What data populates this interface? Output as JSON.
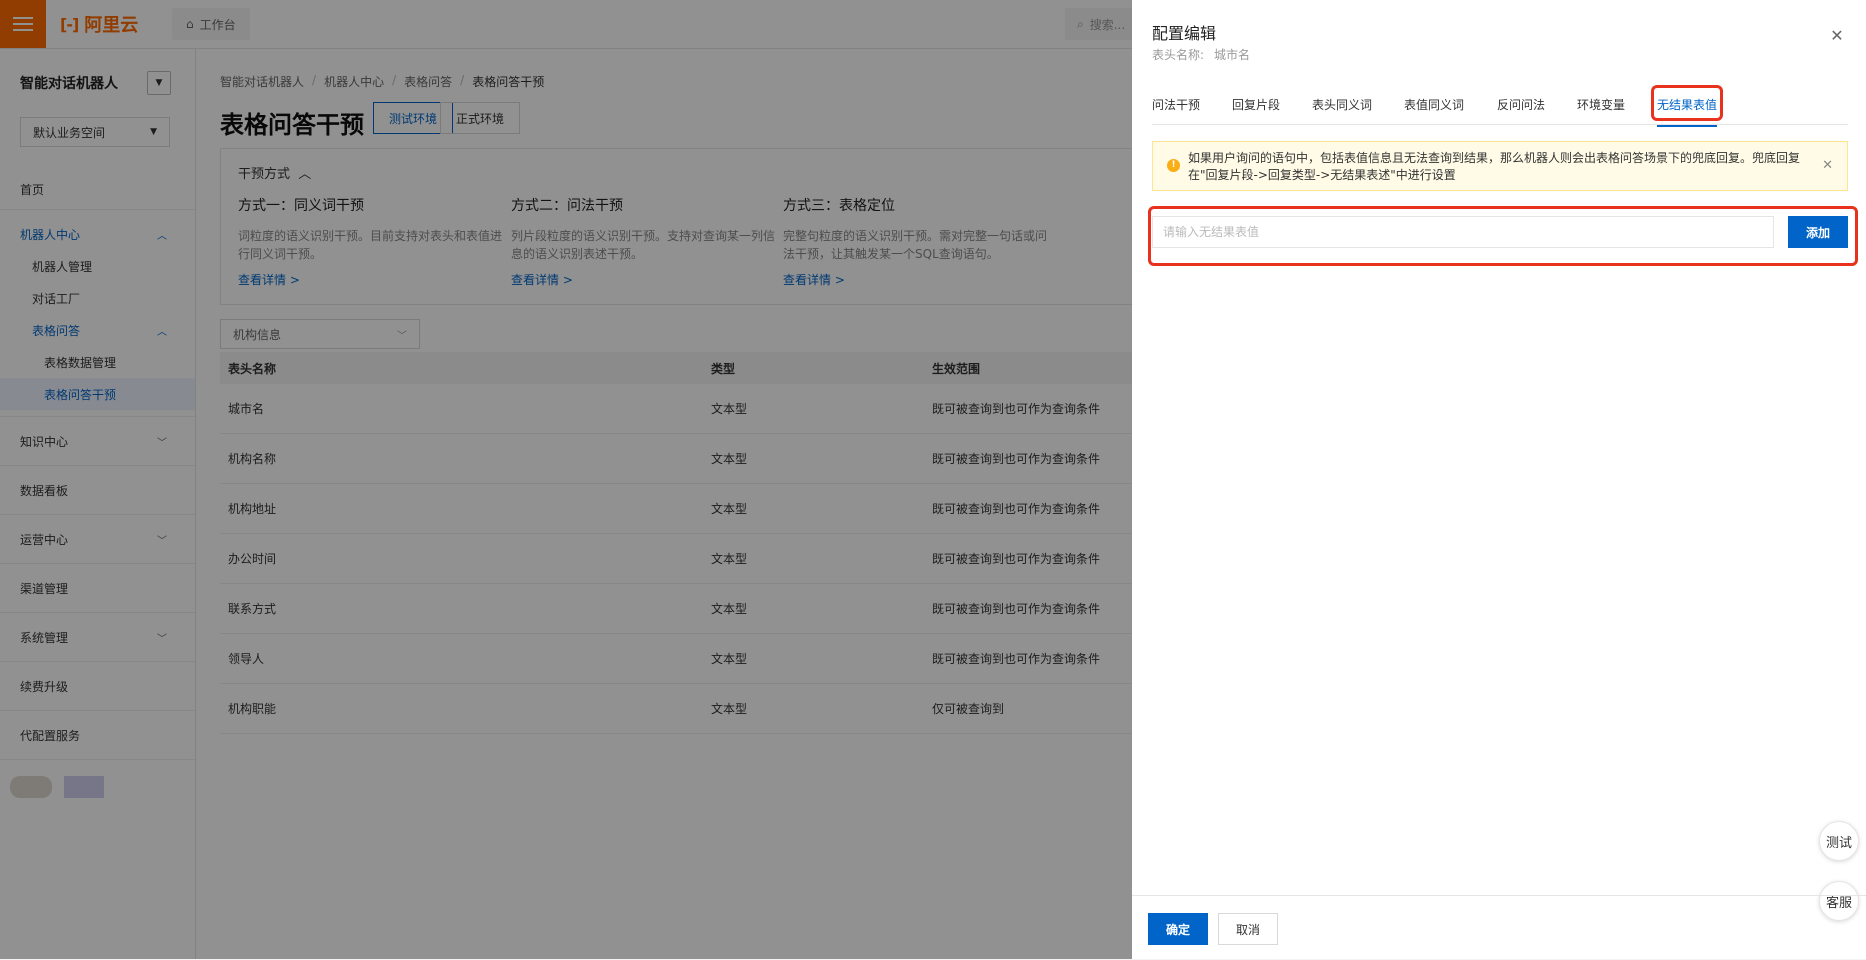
{
  "topbar": {
    "logo_text": "阿里云",
    "logo_mark": "[-]",
    "workspace_label": "工作台",
    "search_placeholder": "搜索..."
  },
  "sidebar": {
    "title": "智能对话机器人",
    "workspace_select": "默认业务空间",
    "items": [
      {
        "label": "首页"
      },
      {
        "label": "机器人中心"
      },
      {
        "label": "机器人管理"
      },
      {
        "label": "对话工厂"
      },
      {
        "label": "表格问答"
      },
      {
        "label": "表格数据管理"
      },
      {
        "label": "表格问答干预"
      },
      {
        "label": "知识中心"
      },
      {
        "label": "数据看板"
      },
      {
        "label": "运营中心"
      },
      {
        "label": "渠道管理"
      },
      {
        "label": "系统管理"
      },
      {
        "label": "续费升级"
      },
      {
        "label": "代配置服务"
      }
    ]
  },
  "main": {
    "breadcrumb": [
      "智能对话机器人",
      "机器人中心",
      "表格问答",
      "表格问答干预"
    ],
    "breadcrumb_sep": "/",
    "title": "表格问答干预",
    "env_test": "测试环境",
    "env_prod": "正式环境",
    "intervene_header": "干预方式",
    "methods": [
      {
        "title": "方式一：同义词干预",
        "desc": "词粒度的语义识别干预。目前支持对表头和表值进行同义词干预。",
        "link": "查看详情 >"
      },
      {
        "title": "方式二：问法干预",
        "desc": "列片段粒度的语义识别干预。支持对查询某一列信息的语义识别表述干预。",
        "link": "查看详情 >"
      },
      {
        "title": "方式三：表格定位",
        "desc": "完整句粒度的语义识别干预。需对完整一句话或问法干预，让其触发某一个SQL查询语句。",
        "link": "查看详情 >"
      }
    ],
    "filter_select": "机构信息",
    "table": {
      "headers": [
        "表头名称",
        "类型",
        "生效范围"
      ],
      "rows": [
        {
          "name": "城市名",
          "type": "文本型",
          "scope": "既可被查询到也可作为查询条件"
        },
        {
          "name": "机构名称",
          "type": "文本型",
          "scope": "既可被查询到也可作为查询条件"
        },
        {
          "name": "机构地址",
          "type": "文本型",
          "scope": "既可被查询到也可作为查询条件"
        },
        {
          "name": "办公时间",
          "type": "文本型",
          "scope": "既可被查询到也可作为查询条件"
        },
        {
          "name": "联系方式",
          "type": "文本型",
          "scope": "既可被查询到也可作为查询条件"
        },
        {
          "name": "领导人",
          "type": "文本型",
          "scope": "既可被查询到也可作为查询条件"
        },
        {
          "name": "机构职能",
          "type": "文本型",
          "scope": "仅可被查询到"
        }
      ]
    }
  },
  "drawer": {
    "title": "配置编辑",
    "subtitle_label": "表头名称:",
    "subtitle_value": "城市名",
    "tabs": [
      "问法干预",
      "回复片段",
      "表头同义词",
      "表值同义词",
      "反问问法",
      "环境变量",
      "无结果表值"
    ],
    "active_tab": "无结果表值",
    "alert_text": "如果用户询问的语句中，包括表值信息且无法查询到结果，那么机器人则会出表格问答场景下的兜底回复。兜底回复在\"回复片段->回复类型->无结果表述\"中进行设置",
    "input_placeholder": "请输入无结果表值",
    "input_value": "",
    "add_button": "添加",
    "confirm_button": "确定",
    "cancel_button": "取消"
  },
  "floating": {
    "test": "测试",
    "service": "客服"
  },
  "colors": {
    "brand_orange": "#ff6a00",
    "primary_blue": "#0064c8",
    "highlight_red": "#e8321e",
    "alert_bg": "#fffbe6"
  }
}
